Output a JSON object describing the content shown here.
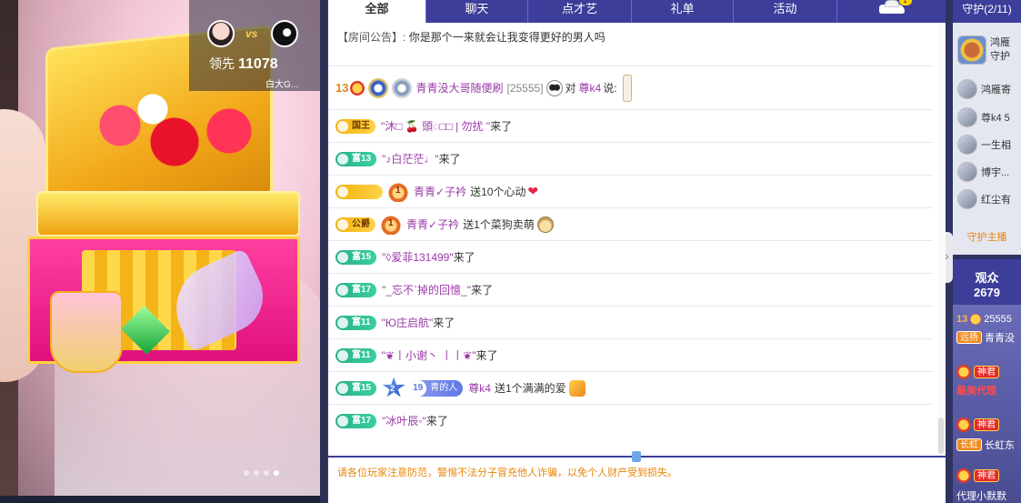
{
  "stream": {
    "pk_vs": "vs",
    "pk_lead_label": "领先",
    "pk_lead_value": "11078",
    "pk_tag": "白大G...",
    "dots": 4,
    "active_dot": 4
  },
  "tabs": [
    {
      "label": "全部",
      "active": true
    },
    {
      "label": "聊天"
    },
    {
      "label": "点才艺"
    },
    {
      "label": "礼单"
    },
    {
      "label": "活动"
    },
    {
      "label": "",
      "icon": "car-icon",
      "badge": "1"
    }
  ],
  "notice": {
    "label": "【房间公告】:",
    "text": "你是那个一来就会让我变得更好的男人吗"
  },
  "messages": [
    {
      "level": "13",
      "user": "青青没大哥随便刷",
      "id": "[25555]",
      "to_label": "对",
      "target": "尊k4",
      "said": "说:"
    },
    {
      "badge": "国王",
      "badge_type": "king",
      "user": "\"沐□ 🍒 頭◌□□ | 勿扰 \"",
      "action": "来了"
    },
    {
      "badge": "富13",
      "badge_type": "rich",
      "user": "\"♪白茫茫♩\"",
      "action": "来了"
    },
    {
      "medal": "1",
      "user": "青青✓子衿",
      "action": "送10个心动"
    },
    {
      "badge": "公爵",
      "badge_type": "duke",
      "medal": "1",
      "user": "青青✓子衿",
      "action": "送1个菜狗卖萌"
    },
    {
      "badge": "富15",
      "badge_type": "rich",
      "user": "\"◊爱菲131499\"",
      "action": "来了"
    },
    {
      "badge": "富17",
      "badge_type": "rich",
      "user": "\"_忘不`掉的回憶_\"",
      "action": "来了"
    },
    {
      "badge": "富11",
      "badge_type": "rich",
      "user": "\"Ю庄启航\"",
      "action": "来了"
    },
    {
      "badge": "富11",
      "badge_type": "rich",
      "user": "\"❦丨小谢丶 丨丨❦\"",
      "action": "来了"
    },
    {
      "badge": "富15",
      "badge_type": "rich",
      "star": "2",
      "fan_level": "19",
      "fan_name": "青的人",
      "user": "尊k4",
      "action": "送1个满满的爱"
    },
    {
      "badge": "富17",
      "badge_type": "rich",
      "user": "\"冰叶辰◦\"",
      "action": "来了"
    }
  ],
  "footer": {
    "warning": "请各位玩家注意防范，警惕不法分子冒充他人诈骗，以免个人财产受到损失。"
  },
  "guard": {
    "title": "守护(2/11)",
    "items": [
      {
        "name": "鸿雁",
        "sub": "守护"
      },
      {
        "name": "鸿雁寄"
      },
      {
        "name": "尊k4 5"
      },
      {
        "name": "一生相"
      },
      {
        "name": "博宇..."
      },
      {
        "name": "红尘有"
      }
    ],
    "more": "守护主播"
  },
  "viewers": {
    "title": "观众",
    "count": "2679",
    "items": [
      {
        "level": "13",
        "id": "25555",
        "tag": "远扬",
        "name": "青青没"
      },
      {
        "tag": "神君",
        "name": "最美代理"
      },
      {
        "tag": "神君",
        "sub_tag": "长虹",
        "name": "长虹东"
      },
      {
        "tag": "神君",
        "name": "代理小默默"
      }
    ]
  }
}
